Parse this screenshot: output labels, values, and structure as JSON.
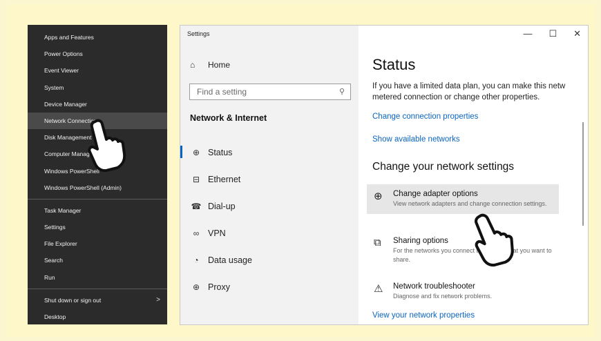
{
  "winx_menu": {
    "items_group1": [
      "Apps and Features",
      "Power Options",
      "Event Viewer",
      "System",
      "Device Manager",
      "Network Connections",
      "Disk Management",
      "Computer Management",
      "Windows PowerShell",
      "Windows PowerShell (Admin)"
    ],
    "items_group2": [
      "Task Manager",
      "Settings",
      "File Explorer",
      "Search",
      "Run"
    ],
    "items_group3": [
      "Shut down or sign out",
      "Desktop"
    ],
    "highlighted": "Network Connections",
    "submenu_arrow": ">"
  },
  "settings": {
    "window_title": "Settings",
    "controls": {
      "minimize": "—",
      "maximize": "☐",
      "close": "✕"
    },
    "home_label": "Home",
    "search_placeholder": "Find a setting",
    "section_title": "Network & Internet",
    "nav": [
      {
        "label": "Status",
        "icon": "globe-icon",
        "selected": true
      },
      {
        "label": "Ethernet",
        "icon": "ethernet-icon"
      },
      {
        "label": "Dial-up",
        "icon": "dialup-icon"
      },
      {
        "label": "VPN",
        "icon": "vpn-icon"
      },
      {
        "label": "Data usage",
        "icon": "data-usage-icon"
      },
      {
        "label": "Proxy",
        "icon": "proxy-icon"
      }
    ],
    "main": {
      "title": "Status",
      "description_line1": "If you have a limited data plan, you can make this netw",
      "description_line2": "metered connection or change other properties.",
      "link_change_connection": "Change connection properties",
      "link_show_networks": "Show available networks",
      "subheading": "Change your network settings",
      "options": [
        {
          "title": "Change adapter options",
          "desc": "View network adapters and change connection settings.",
          "icon": "adapter-icon",
          "highlighted": true
        },
        {
          "title": "Sharing options",
          "desc": "For the networks you connect to, decide what you want to share.",
          "icon": "sharing-icon"
        },
        {
          "title": "Network troubleshooter",
          "desc": "Diagnose and fix network problems.",
          "icon": "warning-icon"
        }
      ],
      "link_view_properties": "View your network properties"
    }
  },
  "colors": {
    "accent": "#0a64c2",
    "menu_bg": "#2b2b2b",
    "background": "#fbf6cf"
  }
}
